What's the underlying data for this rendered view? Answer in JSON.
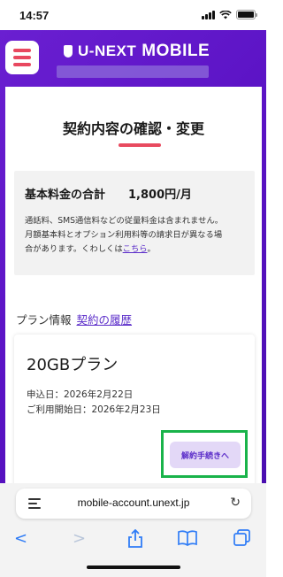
{
  "status_bar": {
    "time": "14:57"
  },
  "header": {
    "brand_part1": "U-NEXT",
    "brand_part2": "MOBILE"
  },
  "page": {
    "title": "契約内容の確認・変更"
  },
  "fee": {
    "label": "基本料金の合計",
    "value": "1,800円/月",
    "note_line1": "通話料、SMS通信料などの従量料金は含まれません。",
    "note_line2": "月額基本料とオプション利用料等の請求日が異なる場",
    "note_line3_prefix": "合があります。くわしくは",
    "note_link": "こちら",
    "note_suffix": "。"
  },
  "plan_section": {
    "label": "プラン情報",
    "history_link": "契約の履歴"
  },
  "plan": {
    "name": "20GBプラン",
    "applied_date": "申込日：2026年2月22日",
    "start_date": "ご利用開始日：2026年2月23日",
    "cancel_button": "解約手続きへ"
  },
  "browser": {
    "url": "mobile-account.unext.jp"
  },
  "colors": {
    "brand_purple": "#5a12c4",
    "accent_red": "#e84a5f",
    "link_purple": "#5b2dc9",
    "highlight_green": "#19b34a",
    "safari_blue": "#2f7cf6"
  }
}
